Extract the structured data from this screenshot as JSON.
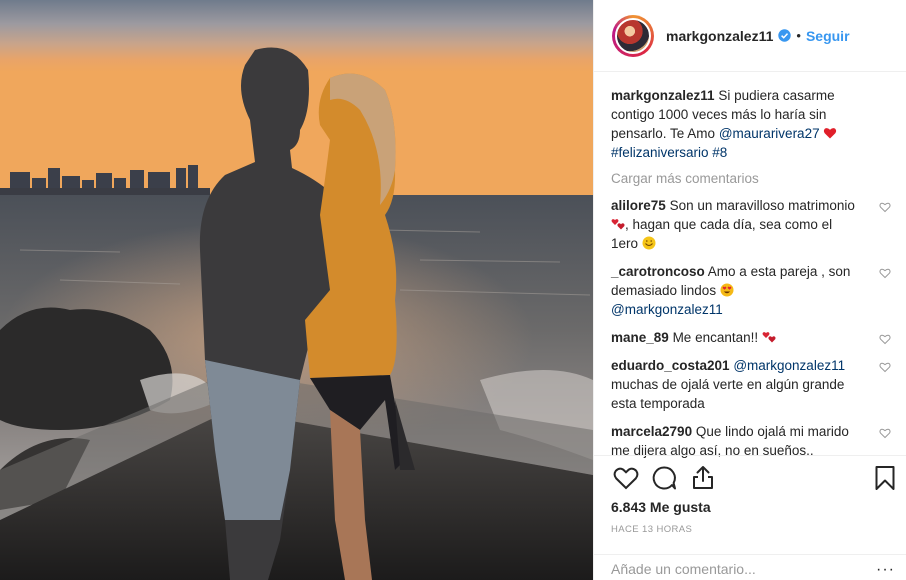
{
  "post": {
    "author": "markgonzalez11",
    "follow_label": "Seguir",
    "separator": "•",
    "caption": {
      "user": "markgonzalez11",
      "text": "Si pudiera casarme contigo 1000 veces más lo haría sin pensarlo. Te Amo",
      "mention": "@maurarivera27",
      "hashtags": "#felizaniversario #8"
    },
    "load_more_label": "Cargar más comentarios",
    "comments": [
      {
        "user": "alilore75",
        "text": "Son un maravilloso matrimonio",
        "text2": ", hagan que cada día, sea como el 1ero"
      },
      {
        "user": "_carotroncoso",
        "text": "Amo a esta pareja , son demasiado lindos",
        "mention": "@markgonzalez11"
      },
      {
        "user": "mane_89",
        "text": "Me encantan!!"
      },
      {
        "user": "eduardo_costa201",
        "mention": "@markgonzalez11",
        "text": "muchas de ojalá verte en algún grande esta temporada"
      },
      {
        "user": "marcela2790",
        "text": "Que lindo ojalá mi marido me dijera algo así, no en sueños.."
      }
    ],
    "likes_text": "6.843 Me gusta",
    "timestamp": "Hace 13 horas",
    "add_comment_placeholder": "Añade un comentario...",
    "more_options": "···"
  },
  "icons": {
    "verified": "verified-badge-icon",
    "like": "heart-icon",
    "comment": "comment-bubble-icon",
    "share": "share-icon",
    "save": "bookmark-icon"
  },
  "colors": {
    "link": "#3897f0",
    "mention": "#003569",
    "muted": "#999999",
    "heart": "#ed4956"
  }
}
